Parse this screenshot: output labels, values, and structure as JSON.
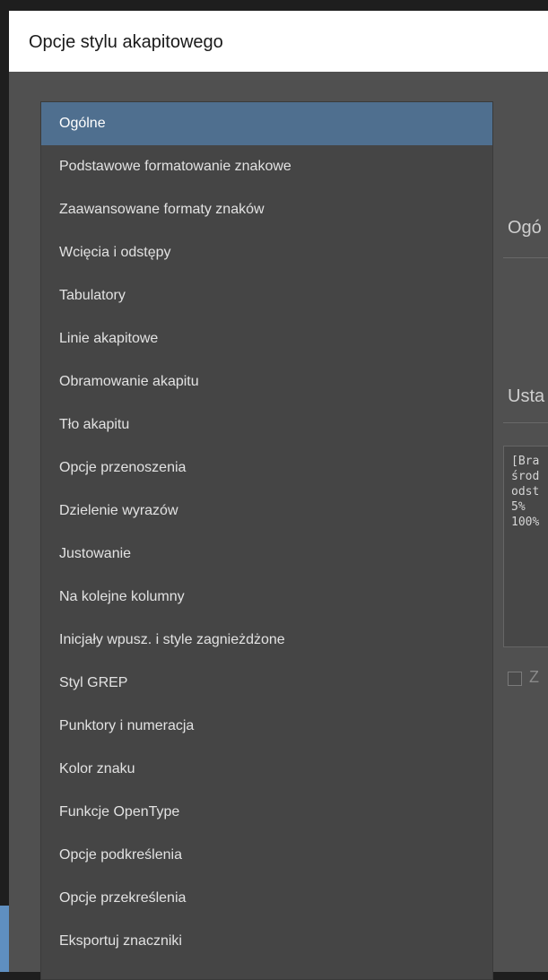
{
  "window": {
    "title": "Opcje stylu akapitowego"
  },
  "sidebar": {
    "items": [
      {
        "label": "Ogólne",
        "selected": true
      },
      {
        "label": "Podstawowe formatowanie znakowe"
      },
      {
        "label": "Zaawansowane formaty znaków"
      },
      {
        "label": "Wcięcia i odstępy"
      },
      {
        "label": "Tabulatory"
      },
      {
        "label": "Linie akapitowe"
      },
      {
        "label": "Obramowanie akapitu"
      },
      {
        "label": "Tło akapitu"
      },
      {
        "label": "Opcje przenoszenia"
      },
      {
        "label": "Dzielenie wyrazów"
      },
      {
        "label": "Justowanie"
      },
      {
        "label": "Na kolejne kolumny"
      },
      {
        "label": "Inicjały wpusz. i style zagnieżdżone"
      },
      {
        "label": "Styl GREP"
      },
      {
        "label": "Punktory i numeracja"
      },
      {
        "label": "Kolor znaku"
      },
      {
        "label": "Funkcje OpenType"
      },
      {
        "label": "Opcje podkreślenia"
      },
      {
        "label": "Opcje przekreślenia"
      },
      {
        "label": "Eksportuj znaczniki"
      }
    ]
  },
  "main": {
    "general_heading": "Ogó",
    "settings_heading": "Usta",
    "settings_lines": [
      "[Bra",
      "środ",
      "odst",
      "5%",
      "100%"
    ],
    "checkbox_label": "Z",
    "checkbox_checked": false
  },
  "colors": {
    "dialog_bg": "#505050",
    "sidebar_bg": "#454545",
    "selection": "#4f6f8f"
  }
}
